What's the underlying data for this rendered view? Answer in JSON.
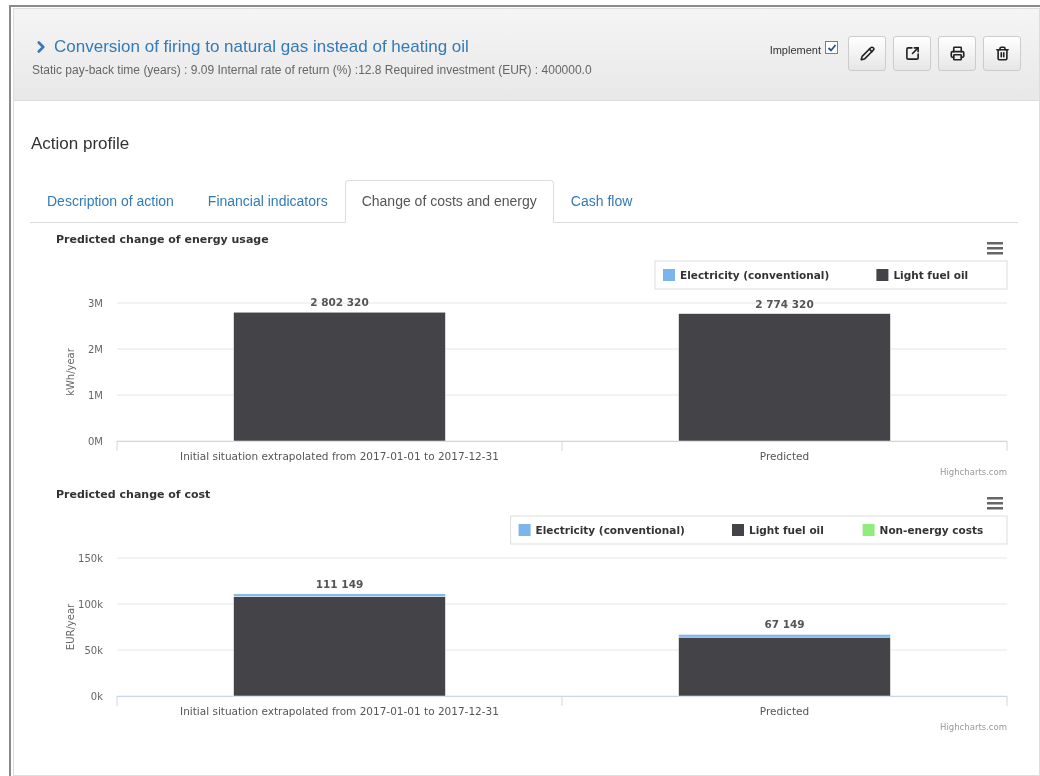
{
  "header": {
    "title": "Conversion of firing to natural gas instead of heating oil",
    "summary": "Static pay-back time (years) : 9.09 Internal rate of return (%) :12.8 Required investment (EUR) : 400000.0",
    "implement": {
      "label": "Implement",
      "checked": true
    },
    "actions": [
      {
        "kind": "edit"
      },
      {
        "kind": "open"
      },
      {
        "kind": "print"
      },
      {
        "kind": "delete"
      }
    ]
  },
  "section_title": "Action profile",
  "tabs": [
    {
      "label": "Description of action",
      "selected": false
    },
    {
      "label": "Financial indicators",
      "selected": false
    },
    {
      "label": "Change of costs and energy",
      "selected": true
    },
    {
      "label": "Cash flow",
      "selected": false
    }
  ],
  "charts": [
    {
      "credits": "Highcharts.com",
      "chart_data": {
        "type": "bar",
        "orientation": "vertical",
        "stacked": true,
        "title": "Predicted change of energy usage",
        "ylabel": "kWh/year",
        "categories": [
          "Initial situation extrapolated from 2017-01-01 to 2017-12-31",
          "Predicted"
        ],
        "ylim": [
          0,
          3000000
        ],
        "yticks": [
          {
            "value": 0,
            "label": "0M"
          },
          {
            "value": 1000000,
            "label": "1M"
          },
          {
            "value": 2000000,
            "label": "2M"
          },
          {
            "value": 3000000,
            "label": "3M"
          }
        ],
        "value_labels": [
          "2 802 320",
          "2 774 320"
        ],
        "legend": "top-right",
        "series": [
          {
            "name": "Electricity (conventional)",
            "color": "#7cb5ec",
            "values": [
              0,
              0
            ]
          },
          {
            "name": "Light fuel oil",
            "color": "#434348",
            "values": [
              2800000,
              2770000
            ]
          }
        ]
      }
    },
    {
      "credits": "Highcharts.com",
      "chart_data": {
        "type": "bar",
        "orientation": "vertical",
        "stacked": true,
        "title": "Predicted change of cost",
        "ylabel": "EUR/year",
        "categories": [
          "Initial situation extrapolated from 2017-01-01 to 2017-12-31",
          "Predicted"
        ],
        "ylim": [
          0,
          150000
        ],
        "yticks": [
          {
            "value": 0,
            "label": "0k"
          },
          {
            "value": 50000,
            "label": "50k"
          },
          {
            "value": 100000,
            "label": "100k"
          },
          {
            "value": 150000,
            "label": "150k"
          }
        ],
        "value_labels": [
          "111 149",
          "67 149"
        ],
        "legend": "top-right",
        "series": [
          {
            "name": "Electricity (conventional)",
            "color": "#7cb5ec",
            "values": [
              3000,
              3000
            ]
          },
          {
            "name": "Light fuel oil",
            "color": "#434348",
            "values": [
              108000,
              64000
            ]
          },
          {
            "name": "Non-energy costs",
            "color": "#90ed7d",
            "values": [
              0,
              0
            ]
          }
        ]
      }
    }
  ]
}
